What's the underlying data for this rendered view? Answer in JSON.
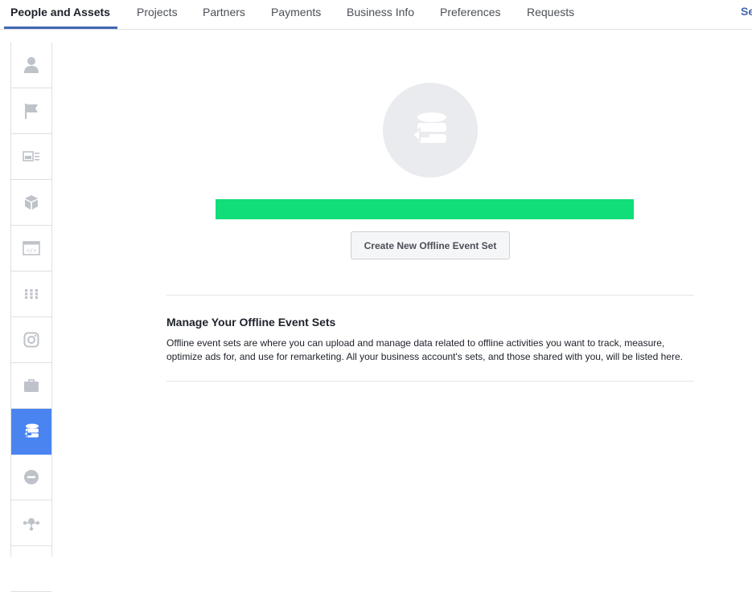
{
  "topnav": {
    "tabs": [
      {
        "label": "People and Assets",
        "active": true
      },
      {
        "label": "Projects"
      },
      {
        "label": "Partners"
      },
      {
        "label": "Payments"
      },
      {
        "label": "Business Info"
      },
      {
        "label": "Preferences"
      },
      {
        "label": "Requests"
      }
    ],
    "overflow_label": "Se"
  },
  "sidebar": {
    "items": [
      {
        "icon": "person-icon"
      },
      {
        "icon": "flag-icon"
      },
      {
        "icon": "ad-account-icon"
      },
      {
        "icon": "cube-icon"
      },
      {
        "icon": "code-window-icon"
      },
      {
        "icon": "grid-icon"
      },
      {
        "icon": "instagram-icon"
      },
      {
        "icon": "briefcase-icon"
      },
      {
        "icon": "offline-event-set-icon",
        "active": true
      },
      {
        "icon": "minus-circle-icon"
      },
      {
        "icon": "network-icon"
      }
    ]
  },
  "main": {
    "create_button_label": "Create New Offline Event Set",
    "section_title": "Manage Your Offline Event Sets",
    "section_description": "Offline event sets are where you can upload and manage data related to offline activities you want to track, measure, optimize ads for, and use for remarketing. All your business account's sets, and those shared with you, will be listed here."
  },
  "colors": {
    "accent": "#4267b2",
    "sidebar_active": "#4a84f1",
    "highlight_bar": "#11de78"
  }
}
